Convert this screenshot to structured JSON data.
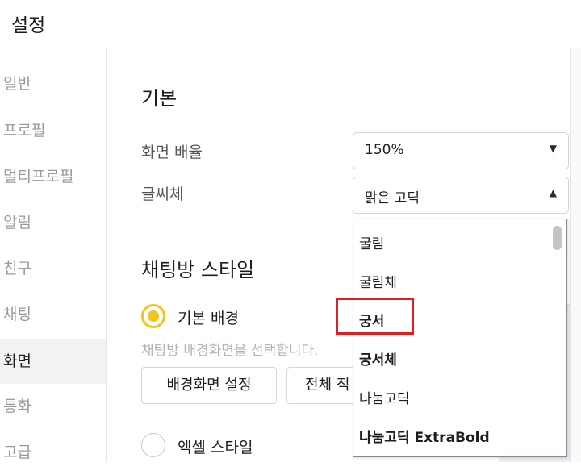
{
  "header": {
    "title": "설정"
  },
  "sidebar": {
    "items": [
      {
        "label": "일반"
      },
      {
        "label": "프로필"
      },
      {
        "label": "멀티프로필"
      },
      {
        "label": "알림"
      },
      {
        "label": "친구"
      },
      {
        "label": "채팅"
      },
      {
        "label": "화면",
        "active": true
      },
      {
        "label": "통화"
      },
      {
        "label": "고급"
      }
    ]
  },
  "main": {
    "basic": {
      "title": "기본",
      "zoom_label": "화면 배율",
      "zoom_value": "150%",
      "font_label": "글씨체",
      "font_value": "맑은 고딕"
    },
    "chat_style": {
      "title": "채팅방 스타일",
      "default_bg_label": "기본 배경",
      "default_bg_desc": "채팅방 배경화면을 선택합니다.",
      "set_bg_button": "배경화면 설정",
      "apply_all_button": "전체 적",
      "excel_style_label": "엑셀 스타일"
    }
  },
  "font_dropdown": {
    "options": [
      "굴림",
      "굴림체",
      "궁서",
      "궁서체",
      "나눔고딕",
      "나눔고딕 ExtraBold"
    ],
    "highlighted": "궁서"
  },
  "colors": {
    "accent": "#f2c51c",
    "highlight_box": "#e02020"
  },
  "icons": {
    "select_closed": "chevron-down-icon",
    "select_open": "chevron-up-icon"
  }
}
